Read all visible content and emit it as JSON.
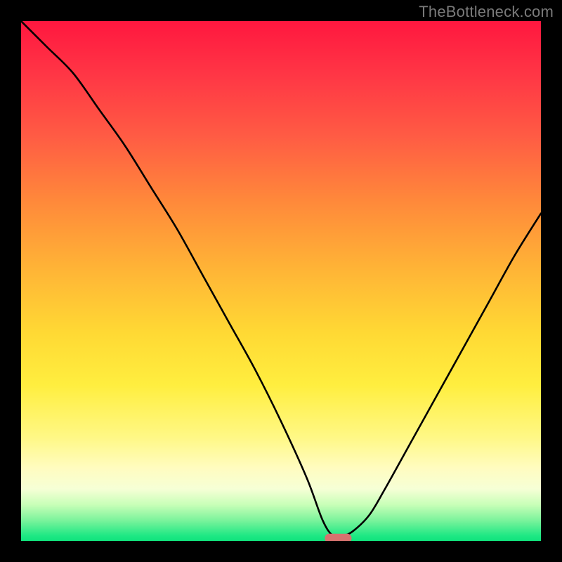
{
  "watermark": "TheBottleneck.com",
  "chart_data": {
    "type": "line",
    "title": "",
    "xlabel": "",
    "ylabel": "",
    "xlim": [
      0,
      1
    ],
    "ylim": [
      0,
      1
    ],
    "series": [
      {
        "name": "bottleneck-curve",
        "x": [
          0.0,
          0.05,
          0.1,
          0.15,
          0.2,
          0.25,
          0.3,
          0.35,
          0.4,
          0.45,
          0.5,
          0.55,
          0.58,
          0.6,
          0.62,
          0.64,
          0.67,
          0.7,
          0.75,
          0.8,
          0.85,
          0.9,
          0.95,
          1.0
        ],
        "values": [
          1.0,
          0.95,
          0.9,
          0.83,
          0.76,
          0.68,
          0.6,
          0.51,
          0.42,
          0.33,
          0.23,
          0.12,
          0.04,
          0.01,
          0.01,
          0.02,
          0.05,
          0.1,
          0.19,
          0.28,
          0.37,
          0.46,
          0.55,
          0.63
        ]
      }
    ],
    "marker": {
      "name": "optimal-point",
      "x": 0.61,
      "y": 0.005,
      "color": "#d7736f"
    },
    "background_gradient": {
      "top": "#ff173f",
      "mid": "#ffd934",
      "bottom": "#10e37d"
    }
  }
}
